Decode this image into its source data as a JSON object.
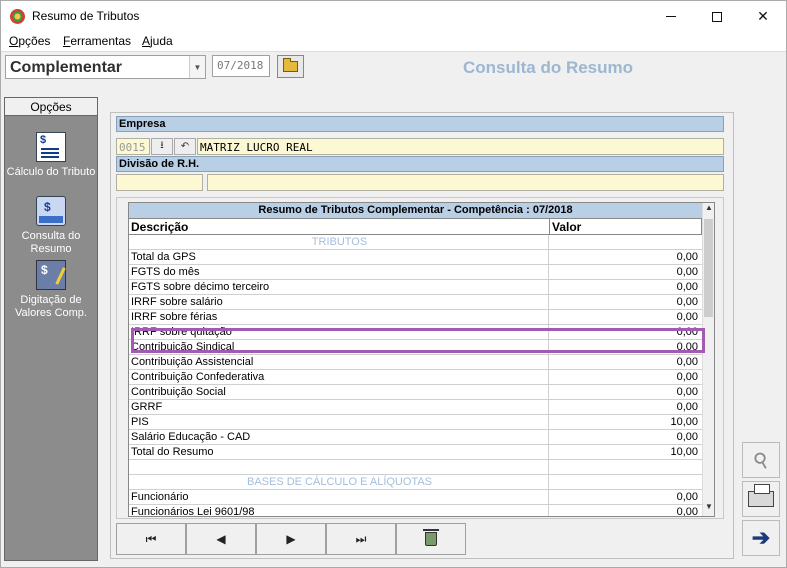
{
  "window": {
    "title": "Resumo de Tributos",
    "min_glyph": "—",
    "max_glyph": "☐",
    "close_glyph": "✕"
  },
  "menu": [
    {
      "label": "Opções",
      "accel": "O"
    },
    {
      "label": "Ferramentas",
      "accel": "F"
    },
    {
      "label": "Ajuda",
      "accel": "A"
    }
  ],
  "toolbar": {
    "type_value": "Complementar",
    "competencia": "07/2018",
    "screen_title": "Consulta do Resumo"
  },
  "sidebar": {
    "header": "Opções",
    "items": [
      {
        "label": "Cálculo do Tributo",
        "icon": "calc-icon"
      },
      {
        "label": "Consulta do Resumo",
        "icon": "consult-icon"
      },
      {
        "label": "Digitação de Valores Comp.",
        "icon": "digit-icon"
      }
    ]
  },
  "company": {
    "empresa_label": "Empresa",
    "code": "0015",
    "name": "MATRIZ LUCRO REAL",
    "divisao_label": "Divisão de R.H.",
    "divisao_code": "",
    "divisao_name": ""
  },
  "grid": {
    "title": "Resumo de Tributos Complementar - Competência : 07/2018",
    "col_desc": "Descrição",
    "col_val": "Valor",
    "rows": [
      {
        "desc": "TRIBUTOS",
        "val": "",
        "section": true
      },
      {
        "desc": "Total da GPS",
        "val": "0,00"
      },
      {
        "desc": "FGTS do mês",
        "val": "0,00"
      },
      {
        "desc": "FGTS sobre décimo terceiro",
        "val": "0,00"
      },
      {
        "desc": "IRRF sobre salário",
        "val": "0,00"
      },
      {
        "desc": "IRRF sobre férias",
        "val": "0,00"
      },
      {
        "desc": "IRRF sobre quitação",
        "val": "0,00"
      },
      {
        "desc": "Contribuição Sindical",
        "val": "0,00"
      },
      {
        "desc": "Contribuição Assistencial",
        "val": "0,00"
      },
      {
        "desc": "Contribuição Confederativa",
        "val": "0,00"
      },
      {
        "desc": "Contribuição Social",
        "val": "0,00"
      },
      {
        "desc": "GRRF",
        "val": "0,00"
      },
      {
        "desc": "PIS",
        "val": "10,00"
      },
      {
        "desc": "Salário Educação - CAD",
        "val": "0,00"
      },
      {
        "desc": "Total do Resumo",
        "val": "10,00"
      },
      {
        "desc": "",
        "val": ""
      },
      {
        "desc": "BASES DE CÁLCULO E ALÍQUOTAS",
        "val": "",
        "section": true
      },
      {
        "desc": "Funcionário",
        "val": "0,00"
      },
      {
        "desc": "Funcionários Lei 9601/98",
        "val": "0,00"
      }
    ]
  },
  "nav": {
    "first": "⏮",
    "prev": "◀",
    "next": "▶",
    "last": "⏭"
  },
  "tools": {
    "search": "⚲",
    "exit": "➔"
  }
}
